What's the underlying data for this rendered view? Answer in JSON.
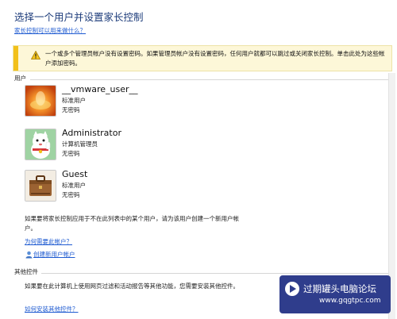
{
  "page": {
    "title": "选择一个用户并设置家长控制",
    "help_link": "家长控制可以用来做什么？"
  },
  "warning": {
    "icon": "warning-icon",
    "text": "一个或多个管理员帐户没有设置密码。如果管理员帐户没有设置密码，任何用户就都可以跳过或关闭家长控制。单击此处为这些帐户添加密码。"
  },
  "users_section": {
    "label": "用户",
    "users": [
      {
        "name": "__vmware_user__",
        "role": "标准用户",
        "password": "无密码",
        "avatar": "orange-flower-avatar"
      },
      {
        "name": "Administrator",
        "role": "计算机管理员",
        "password": "无密码",
        "avatar": "lucky-cat-avatar"
      },
      {
        "name": "Guest",
        "role": "标准用户",
        "password": "无密码",
        "avatar": "briefcase-avatar"
      }
    ],
    "note": "如果要将家长控制应用于不在此列表中的某个用户，请为该用户创建一个新用户帐户。",
    "why_link": "为何需要此帐户？",
    "create_link": "创建新用户帐户"
  },
  "other_controls": {
    "label": "其他控件",
    "note": "如果要在此计算机上使用网页过滤和活动报告等其他功能，您需要安装其他控件。",
    "install_link": "如何安装其他控件？"
  },
  "watermark": {
    "text": "过期罐头电脑论坛",
    "url": "www.gqgtpc.com"
  },
  "colors": {
    "title": "#1e3d7b",
    "link": "#1f5bd1",
    "warning_bg": "#fdf7d8",
    "warning_bar": "#f2c01a",
    "watermark_bg": "#2f3d8c"
  }
}
